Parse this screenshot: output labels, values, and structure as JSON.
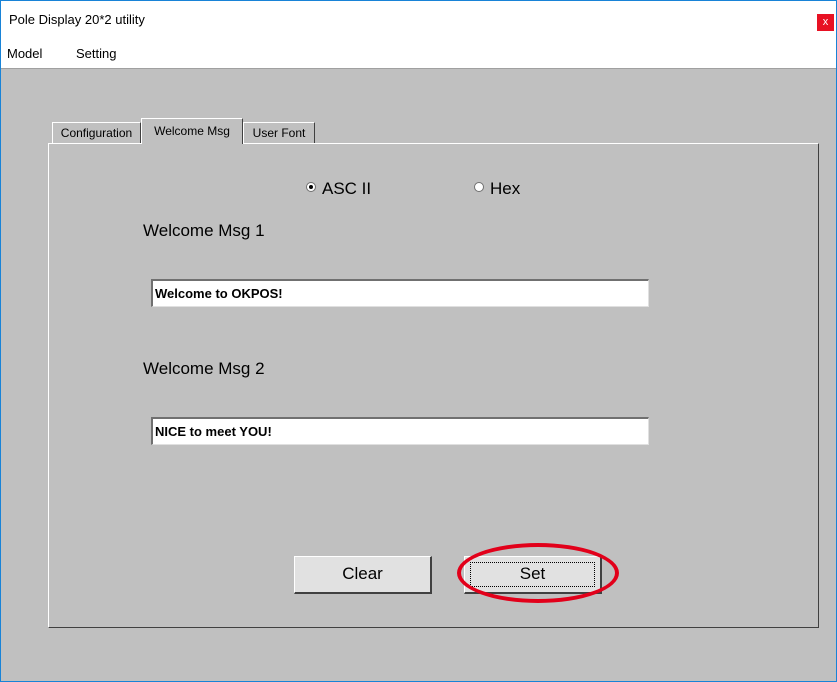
{
  "window": {
    "title": "Pole Display 20*2 utility",
    "close_label": "x"
  },
  "menu": {
    "items": [
      "Model",
      "Setting"
    ]
  },
  "tabs": [
    {
      "label": "Configuration",
      "active": false
    },
    {
      "label": "Welcome Msg",
      "active": true
    },
    {
      "label": "User Font",
      "active": false
    }
  ],
  "encoding": {
    "options": [
      {
        "label": "ASC II",
        "selected": true
      },
      {
        "label": "Hex",
        "selected": false
      }
    ]
  },
  "msg1": {
    "label": "Welcome Msg 1",
    "value": "Welcome to OKPOS!"
  },
  "msg2": {
    "label": "Welcome Msg 2",
    "value": "NICE to meet YOU!"
  },
  "buttons": {
    "clear": "Clear",
    "set": "Set"
  },
  "colors": {
    "window_border": "#1883d7",
    "close_bg": "#e81123",
    "highlight": "#e2001a",
    "face": "#c0c0c0"
  }
}
